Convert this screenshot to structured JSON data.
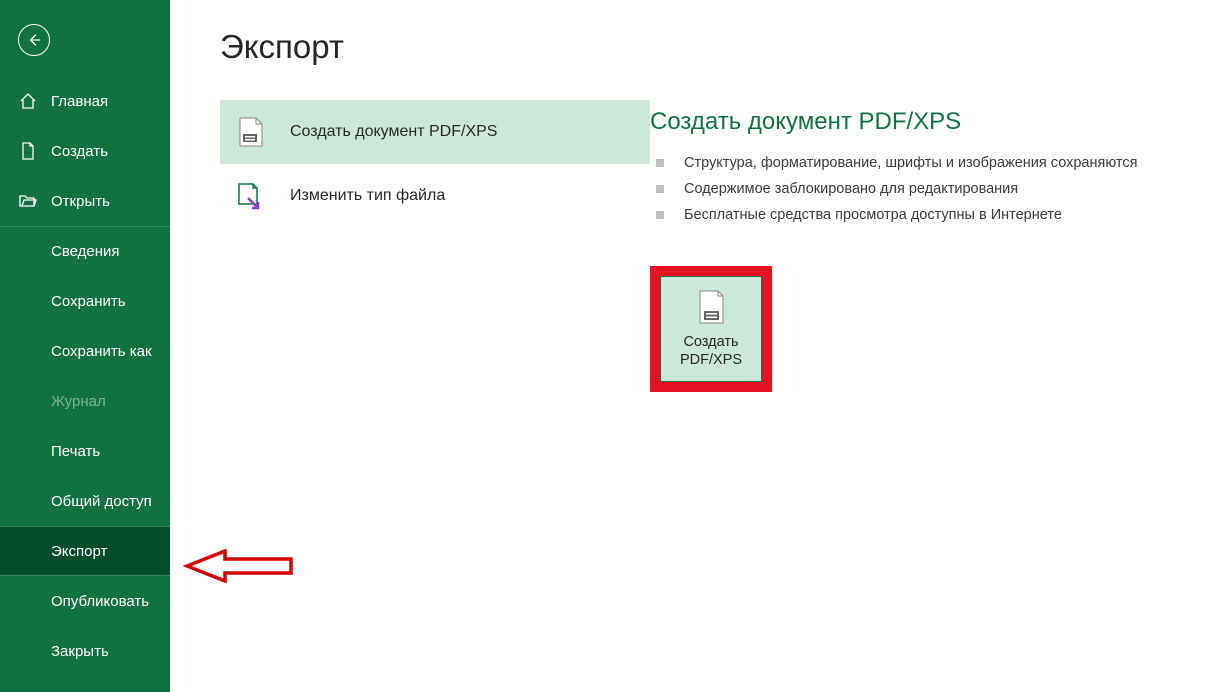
{
  "sidebar": {
    "items": [
      {
        "label": "Главная",
        "icon": "home"
      },
      {
        "label": "Создать",
        "icon": "new-doc"
      },
      {
        "label": "Открыть",
        "icon": "folder-open"
      },
      {
        "label": "Сведения"
      },
      {
        "label": "Сохранить"
      },
      {
        "label": "Сохранить как"
      },
      {
        "label": "Журнал",
        "disabled": true
      },
      {
        "label": "Печать"
      },
      {
        "label": "Общий доступ"
      },
      {
        "label": "Экспорт",
        "selected": true
      },
      {
        "label": "Опубликовать"
      },
      {
        "label": "Закрыть"
      }
    ]
  },
  "main": {
    "title": "Экспорт",
    "options": [
      {
        "label": "Создать документ PDF/XPS",
        "selected": true
      },
      {
        "label": "Изменить тип файла"
      }
    ],
    "section": {
      "title": "Создать документ PDF/XPS",
      "bullets": [
        "Структура, форматирование, шрифты и изображения сохраняются",
        "Содержимое заблокировано для редактирования",
        "Бесплатные средства просмотра доступны в Интернете"
      ],
      "button_label": "Создать\nPDF/XPS"
    }
  }
}
